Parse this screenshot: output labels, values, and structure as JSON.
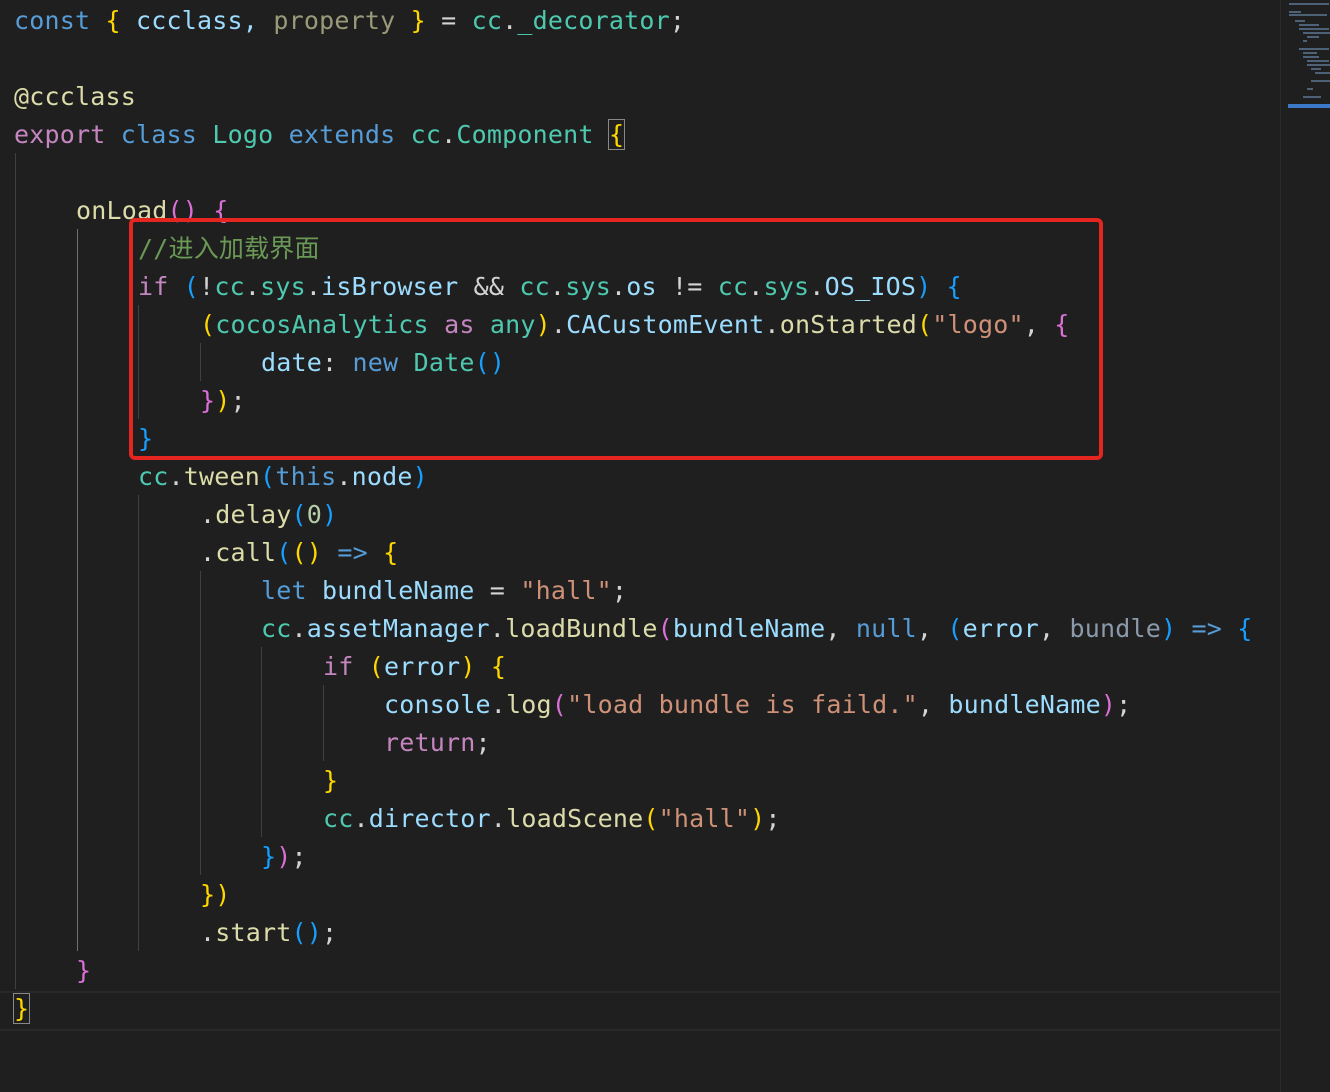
{
  "colors": {
    "background": "#1f1f1f",
    "keyword_blue": "#569cd6",
    "keyword_purple": "#c586c0",
    "type_teal": "#4ec9b0",
    "variable": "#9cdcfe",
    "function": "#dcdcaa",
    "string": "#ce9178",
    "number": "#b5cea8",
    "comment": "#6a9955",
    "bracket_gold": "#ffd700",
    "bracket_pink": "#da70d6",
    "bracket_blue": "#179fff",
    "highlight_box": "#e5251f"
  },
  "code": {
    "l1": {
      "t1": "const",
      "t2": " ",
      "t3": "{",
      "t4": " ccclass, ",
      "t5": "property",
      "t6": " ",
      "t7": "}",
      "t8": " = ",
      "t9": "cc",
      "t10": ".",
      "t11": "_decorator",
      "t12": ";"
    },
    "l3": {
      "t1": "@",
      "t2": "ccclass"
    },
    "l4": {
      "t1": "export",
      "t2": " ",
      "t3": "class",
      "t4": " ",
      "t5": "Logo",
      "t6": " ",
      "t7": "extends",
      "t8": " ",
      "t9": "cc",
      "t10": ".",
      "t11": "Component",
      "t12": " ",
      "t13": "{"
    },
    "l6": {
      "t1": "onLoad",
      "t2": "()",
      "t3": " ",
      "t4": "{"
    },
    "l7": {
      "t1": "//进入加载界面"
    },
    "l8": {
      "t1": "if",
      "t2": " ",
      "t3": "(",
      "t4": "!",
      "t5": "cc",
      "t6": ".",
      "t7": "sys",
      "t8": ".",
      "t9": "isBrowser",
      "t10": " && ",
      "t11": "cc",
      "t12": ".",
      "t13": "sys",
      "t14": ".",
      "t15": "os",
      "t16": " != ",
      "t17": "cc",
      "t18": ".",
      "t19": "sys",
      "t20": ".",
      "t21": "OS_IOS",
      "t22": ")",
      "t23": " ",
      "t24": "{"
    },
    "l9": {
      "t1": "(",
      "t2": "cocosAnalytics",
      "t3": " ",
      "t4": "as",
      "t5": " ",
      "t6": "any",
      "t7": ")",
      "t8": ".",
      "t9": "CACustomEvent",
      "t10": ".",
      "t11": "onStarted",
      "t12": "(",
      "t13": "\"logo\"",
      "t14": ", ",
      "t15": "{"
    },
    "l10": {
      "t1": "date",
      "t2": ": ",
      "t3": "new",
      "t4": " ",
      "t5": "Date",
      "t6": "()"
    },
    "l11": {
      "t1": "}",
      "t2": ")",
      "t3": ";"
    },
    "l12": {
      "t1": "}"
    },
    "l13": {
      "t1": "cc",
      "t2": ".",
      "t3": "tween",
      "t4": "(",
      "t5": "this",
      "t6": ".",
      "t7": "node",
      "t8": ")"
    },
    "l14": {
      "t1": ".",
      "t2": "delay",
      "t3": "(",
      "t4": "0",
      "t5": ")"
    },
    "l15": {
      "t1": ".",
      "t2": "call",
      "t3": "(",
      "t4": "()",
      "t5": " ",
      "t6": "=>",
      "t7": " ",
      "t8": "{"
    },
    "l16": {
      "t1": "let",
      "t2": " ",
      "t3": "bundleName",
      "t4": " = ",
      "t5": "\"hall\"",
      "t6": ";"
    },
    "l17": {
      "t1": "cc",
      "t2": ".",
      "t3": "assetManager",
      "t4": ".",
      "t5": "loadBundle",
      "t6": "(",
      "t7": "bundleName",
      "t8": ", ",
      "t9": "null",
      "t10": ", ",
      "t11": "(",
      "t12": "error",
      "t13": ", ",
      "t14": "bundle",
      "t15": ")",
      "t16": " ",
      "t17": "=>",
      "t18": " ",
      "t19": "{"
    },
    "l18": {
      "t1": "if",
      "t2": " ",
      "t3": "(",
      "t4": "error",
      "t5": ")",
      "t6": " ",
      "t7": "{"
    },
    "l19": {
      "t1": "console",
      "t2": ".",
      "t3": "log",
      "t4": "(",
      "t5": "\"load bundle is faild.\"",
      "t6": ", ",
      "t7": "bundleName",
      "t8": ")",
      "t9": ";"
    },
    "l20": {
      "t1": "return",
      "t2": ";"
    },
    "l21": {
      "t1": "}"
    },
    "l22": {
      "t1": "cc",
      "t2": ".",
      "t3": "director",
      "t4": ".",
      "t5": "loadScene",
      "t6": "(",
      "t7": "\"hall\"",
      "t8": ")",
      "t9": ";"
    },
    "l23": {
      "t1": "}",
      "t2": ")",
      "t3": ";"
    },
    "l24": {
      "t1": "})"
    },
    "l25": {
      "t1": ".",
      "t2": "start",
      "t3": "()",
      "t4": ";"
    },
    "l26": {
      "t1": "}"
    },
    "l27": {
      "t1": "}"
    }
  }
}
